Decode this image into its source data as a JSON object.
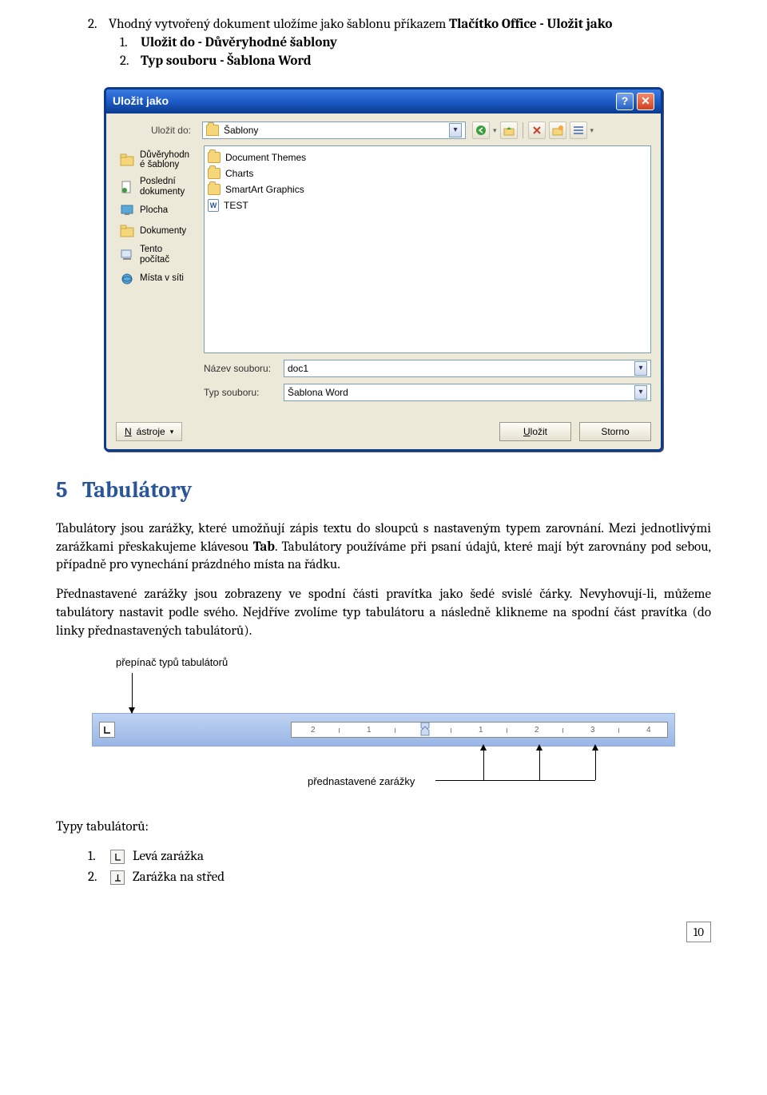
{
  "doc": {
    "line_top_num": "2.",
    "line_top_pre": "Vhodný vytvořený dokument uložíme jako šablonu příkazem ",
    "line_top_bold": "Tlačítko Office - Uložit jako",
    "sub1_num": "1.",
    "sub1_bold": "Uložit do - Důvěryhodné šablony",
    "sub2_num": "2.",
    "sub2_bold": "Typ souboru - Šablona Word",
    "h2_num": "5",
    "h2_title": "Tabulátory",
    "para1_a": "Tabulátory jsou zarážky, které umožňují zápis textu do sloupců s nastaveným typem zarovnání. Mezi jednotlivými zarážkami přeskakujeme klávesou ",
    "para1_bold": "Tab",
    "para1_b": ". Tabulátory používáme při psaní údajů, které mají být zarovnány pod sebou, případně pro vynechání prázdného místa na řádku.",
    "para2": "Přednastavené zarážky jsou zobrazeny ve spodní části pravítka jako šedé svislé čárky. Nevyhovují-li, můžeme tabulátory nastavit podle svého. Nejdříve zvolíme typ tabulátoru a následně klikneme na spodní část pravítka (do linky přednastavených tabulátorů).",
    "fig_lbl1": "přepínač typů tabulátorů",
    "fig_lbl2": "přednastavené zarážky",
    "typy_heading": "Typy tabulátorů:",
    "tab1_num": "1.",
    "tab1_text": "Levá zarážka",
    "tab2_num": "2.",
    "tab2_text": "Zarážka na střed",
    "page_number": "10"
  },
  "dialog": {
    "title": "Uložit jako",
    "save_to_label": "Uložit do:",
    "save_to_value": "Šablony",
    "sidebar": {
      "s0": "Důvěryhodn\né šablony",
      "s1": "Poslední\ndokumenty",
      "s2": "Plocha",
      "s3": "Dokumenty",
      "s4": "Tento\npočítač",
      "s5": "Místa v síti"
    },
    "files": {
      "f0": "Document Themes",
      "f1": "Charts",
      "f2": "SmartArt Graphics",
      "f3": "TEST"
    },
    "name_label": "Název souboru:",
    "name_value": "doc1",
    "type_label": "Typ souboru:",
    "type_value": "Šablona Word",
    "tools_btn": "Nástroje",
    "save_btn": "Uložit",
    "cancel_btn": "Storno"
  },
  "ruler": {
    "n2m": "2",
    "n1m": "1",
    "n1": "1",
    "n2": "2",
    "n3": "3",
    "n4": "4"
  }
}
